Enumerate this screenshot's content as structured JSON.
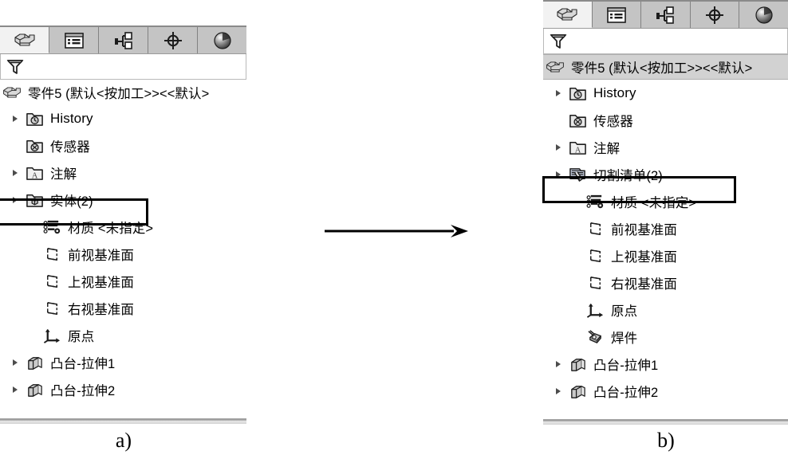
{
  "figure": {
    "arrow": {
      "name": "transformation-arrow",
      "direction": "right"
    },
    "caption_a": "a)",
    "caption_b": "b)"
  },
  "colors": {
    "tab_active_bg": "#f2f2f2",
    "tab_inactive_bg": "#c4c4c4",
    "title_highlight_bg": "#d2d2d2",
    "selection_outline": "#000000",
    "panel_bg": "#ffffff",
    "border": "#b9b9b9"
  },
  "panel_a": {
    "id": "feature-manager-before",
    "tabs": [
      {
        "icon": "feature-tree-icon",
        "label": "",
        "active": true
      },
      {
        "icon": "property-manager-icon",
        "label": "",
        "active": false
      },
      {
        "icon": "configuration-manager-icon",
        "label": "",
        "active": false
      },
      {
        "icon": "dimxpert-manager-icon",
        "label": "",
        "active": false
      },
      {
        "icon": "display-manager-icon",
        "label": "",
        "active": false
      }
    ],
    "filter": {
      "icon": "filter-funnel-icon",
      "placeholder": "",
      "value": ""
    },
    "title": {
      "icon": "part-icon",
      "text": "零件5  (默认<按加工>><<默认>"
    },
    "tree": [
      {
        "icon": "history-folder-icon",
        "label": "History",
        "twisty": true,
        "indent": 1,
        "latin": true,
        "selected": false
      },
      {
        "icon": "sensor-folder-icon",
        "label": "传感器",
        "twisty": false,
        "indent": 1,
        "latin": false,
        "selected": false
      },
      {
        "icon": "annotation-folder-icon",
        "label": "注解",
        "twisty": true,
        "indent": 1,
        "latin": false,
        "selected": false
      },
      {
        "icon": "solid-bodies-folder-icon",
        "label": "实体(2)",
        "twisty": true,
        "indent": 1,
        "latin": false,
        "selected": true
      },
      {
        "icon": "material-icon",
        "label": "材质 <未指定>",
        "twisty": false,
        "indent": 2,
        "latin": false,
        "selected": false
      },
      {
        "icon": "plane-icon",
        "label": "前视基准面",
        "twisty": false,
        "indent": 2,
        "latin": false,
        "selected": false
      },
      {
        "icon": "plane-icon",
        "label": "上视基准面",
        "twisty": false,
        "indent": 2,
        "latin": false,
        "selected": false
      },
      {
        "icon": "plane-icon",
        "label": "右视基准面",
        "twisty": false,
        "indent": 2,
        "latin": false,
        "selected": false
      },
      {
        "icon": "origin-icon",
        "label": "原点",
        "twisty": false,
        "indent": 2,
        "latin": false,
        "selected": false
      },
      {
        "icon": "extrude-boss-icon",
        "label": "凸台-拉伸1",
        "twisty": true,
        "indent": 1,
        "latin": false,
        "selected": false
      },
      {
        "icon": "extrude-boss-icon",
        "label": "凸台-拉伸2",
        "twisty": true,
        "indent": 1,
        "latin": false,
        "selected": false
      }
    ]
  },
  "panel_b": {
    "id": "feature-manager-after",
    "tabs": [
      {
        "icon": "feature-tree-icon",
        "label": "",
        "active": true
      },
      {
        "icon": "property-manager-icon",
        "label": "",
        "active": false
      },
      {
        "icon": "configuration-manager-icon",
        "label": "",
        "active": false
      },
      {
        "icon": "dimxpert-manager-icon",
        "label": "",
        "active": false
      },
      {
        "icon": "display-manager-icon",
        "label": "",
        "active": false
      }
    ],
    "filter": {
      "icon": "filter-funnel-icon",
      "placeholder": "",
      "value": ""
    },
    "title": {
      "icon": "part-icon",
      "text": "零件5  (默认<按加工>><<默认>"
    },
    "tree": [
      {
        "icon": "history-folder-icon",
        "label": "History",
        "twisty": true,
        "indent": 1,
        "latin": true,
        "selected": false
      },
      {
        "icon": "sensor-folder-icon",
        "label": "传感器",
        "twisty": false,
        "indent": 1,
        "latin": false,
        "selected": false
      },
      {
        "icon": "annotation-folder-icon",
        "label": "注解",
        "twisty": true,
        "indent": 1,
        "latin": false,
        "selected": false
      },
      {
        "icon": "cut-list-folder-icon",
        "label": "切割清单(2)",
        "twisty": true,
        "indent": 1,
        "latin": false,
        "selected": true
      },
      {
        "icon": "material-icon",
        "label": "材质 <未指定>",
        "twisty": false,
        "indent": 2,
        "latin": false,
        "selected": false
      },
      {
        "icon": "plane-icon",
        "label": "前视基准面",
        "twisty": false,
        "indent": 2,
        "latin": false,
        "selected": false
      },
      {
        "icon": "plane-icon",
        "label": "上视基准面",
        "twisty": false,
        "indent": 2,
        "latin": false,
        "selected": false
      },
      {
        "icon": "plane-icon",
        "label": "右视基准面",
        "twisty": false,
        "indent": 2,
        "latin": false,
        "selected": false
      },
      {
        "icon": "origin-icon",
        "label": "原点",
        "twisty": false,
        "indent": 2,
        "latin": false,
        "selected": false
      },
      {
        "icon": "weldment-icon",
        "label": "焊件",
        "twisty": false,
        "indent": 2,
        "latin": false,
        "selected": false
      },
      {
        "icon": "extrude-boss-icon",
        "label": "凸台-拉伸1",
        "twisty": true,
        "indent": 1,
        "latin": false,
        "selected": false
      },
      {
        "icon": "extrude-boss-icon",
        "label": "凸台-拉伸2",
        "twisty": true,
        "indent": 1,
        "latin": false,
        "selected": false
      }
    ]
  }
}
